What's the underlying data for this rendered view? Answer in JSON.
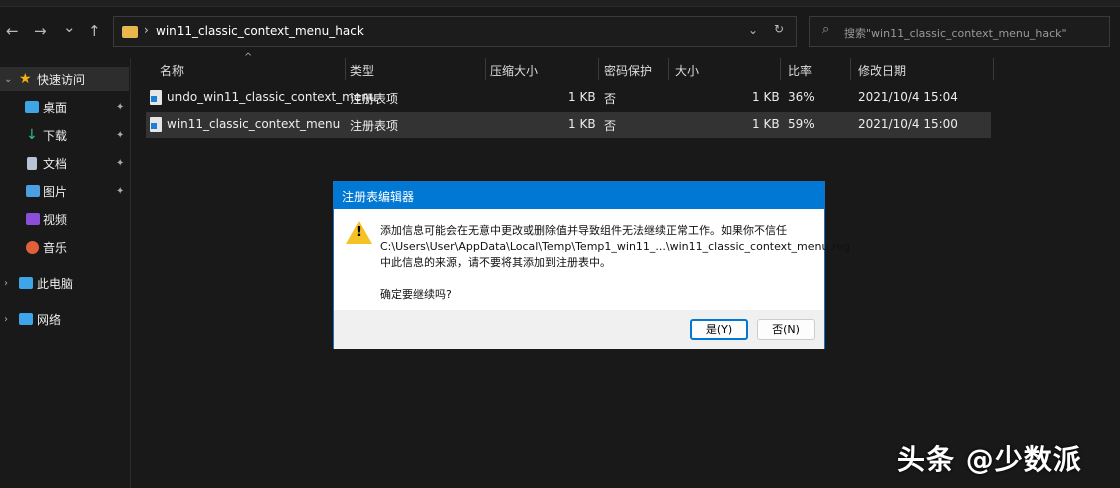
{
  "nav": {
    "back": "←",
    "forward": "→",
    "recent": "⌄",
    "up": "↑"
  },
  "address": {
    "separator": "›",
    "path": "win11_classic_context_menu_hack",
    "dropdown": "⌄",
    "refresh": "↻"
  },
  "search": {
    "icon": "⌕",
    "placeholder": "搜索\"win11_classic_context_menu_hack\""
  },
  "sidebar": {
    "items": [
      {
        "label": "快速访问",
        "icon": "star-icon",
        "color": "#f2b50f"
      },
      {
        "label": "桌面",
        "icon": "desktop-icon",
        "color": "#3ea6e8"
      },
      {
        "label": "下载",
        "icon": "download-icon",
        "color": "#2ec08f"
      },
      {
        "label": "文档",
        "icon": "document-icon",
        "color": "#b8c4d6"
      },
      {
        "label": "图片",
        "icon": "pictures-icon",
        "color": "#4aa0e0"
      },
      {
        "label": "视频",
        "icon": "videos-icon",
        "color": "#8a4fd6"
      },
      {
        "label": "音乐",
        "icon": "music-icon",
        "color": "#e0603a"
      },
      {
        "label": "此电脑",
        "icon": "computer-icon",
        "color": "#3ea6e8"
      },
      {
        "label": "网络",
        "icon": "network-icon",
        "color": "#3ea6e8"
      }
    ],
    "chevron_open": "⌄",
    "chevron_closed": "›",
    "pin": "📌"
  },
  "columns": [
    "名称",
    "类型",
    "压缩大小",
    "密码保护",
    "大小",
    "比率",
    "修改日期"
  ],
  "sort_indicator": "^",
  "files": [
    {
      "name": "undo_win11_classic_context_menu",
      "type": "注册表项",
      "packed": "1 KB",
      "protected": "否",
      "size": "1 KB",
      "ratio": "36%",
      "modified": "2021/10/4 15:04"
    },
    {
      "name": "win11_classic_context_menu",
      "type": "注册表项",
      "packed": "1 KB",
      "protected": "否",
      "size": "1 KB",
      "ratio": "59%",
      "modified": "2021/10/4 15:00"
    }
  ],
  "dialog": {
    "title": "注册表编辑器",
    "lines": [
      "添加信息可能会在无意中更改或删除值并导致组件无法继续正常工作。如果你不信任",
      "C:\\Users\\User\\AppData\\Local\\Temp\\Temp1_win11_...\\win11_classic_context_menu.reg",
      "中此信息的来源，请不要将其添加到注册表中。"
    ],
    "question": "确定要继续吗?",
    "yes": "是(Y)",
    "no": "否(N)",
    "warn_glyph": "!"
  },
  "watermark": "头条 @少数派"
}
